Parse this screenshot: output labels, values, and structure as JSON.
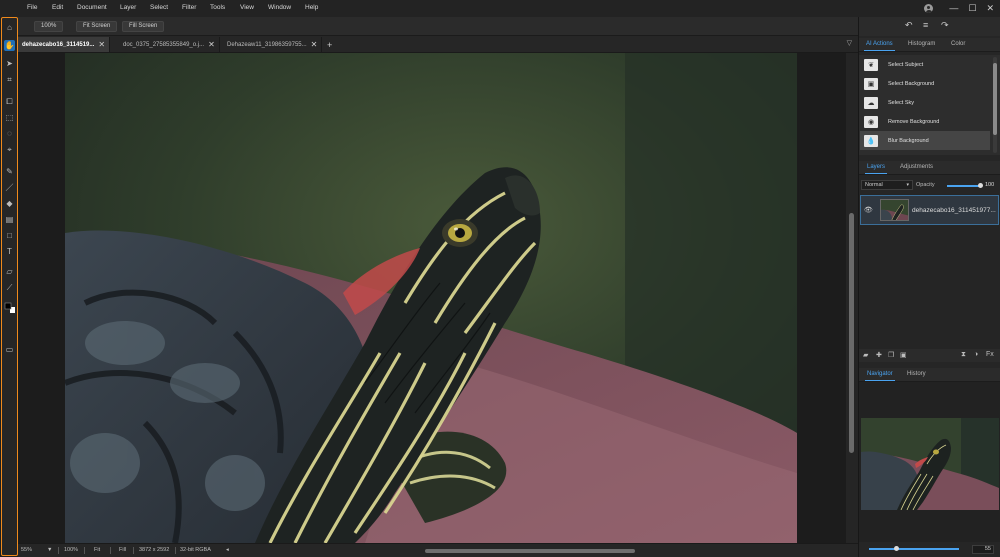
{
  "menu": [
    "File",
    "Edit",
    "Document",
    "Layer",
    "Select",
    "Filter",
    "Tools",
    "View",
    "Window",
    "Help"
  ],
  "window_controls": {
    "minimize": "—",
    "maximize": "☐",
    "close": "✕"
  },
  "options": {
    "zoom": "100%",
    "fit_screen": "Fit Screen",
    "fill_screen": "Fill Screen"
  },
  "tabs": [
    {
      "label": "dehazecabo16_3114519..."
    },
    {
      "label": "doc_0375_27585355849_o.j..."
    },
    {
      "label": "Dehazeaw11_31986359755..."
    }
  ],
  "status": {
    "zoom": "55%",
    "zoom2": "100%",
    "fit": "Fit",
    "fill": "Fill",
    "dimensions": "3872 x 2592",
    "mode": "32-bit RGBA"
  },
  "panel_tabs_top": [
    "AI Actions",
    "Histogram",
    "Color"
  ],
  "ai_actions": [
    {
      "label": "Select Subject",
      "icon": "subject-icon"
    },
    {
      "label": "Select Background",
      "icon": "background-icon"
    },
    {
      "label": "Select Sky",
      "icon": "sky-icon"
    },
    {
      "label": "Remove Background",
      "icon": "remove-bg-icon"
    },
    {
      "label": "Blur Background",
      "icon": "blur-icon"
    }
  ],
  "layer_tabs": [
    "Layers",
    "Adjustments"
  ],
  "layer_opts": {
    "blend": "Normal",
    "opacity_label": "Opacity",
    "opacity_value": "100"
  },
  "layers": [
    {
      "name": "dehazecabo16_311451977..."
    }
  ],
  "nav_tabs": [
    "Navigator",
    "History"
  ],
  "navigator": {
    "zoom_value": "55"
  },
  "colors": {
    "accent": "#4aa3f0",
    "highlight": "#f08a1c"
  }
}
